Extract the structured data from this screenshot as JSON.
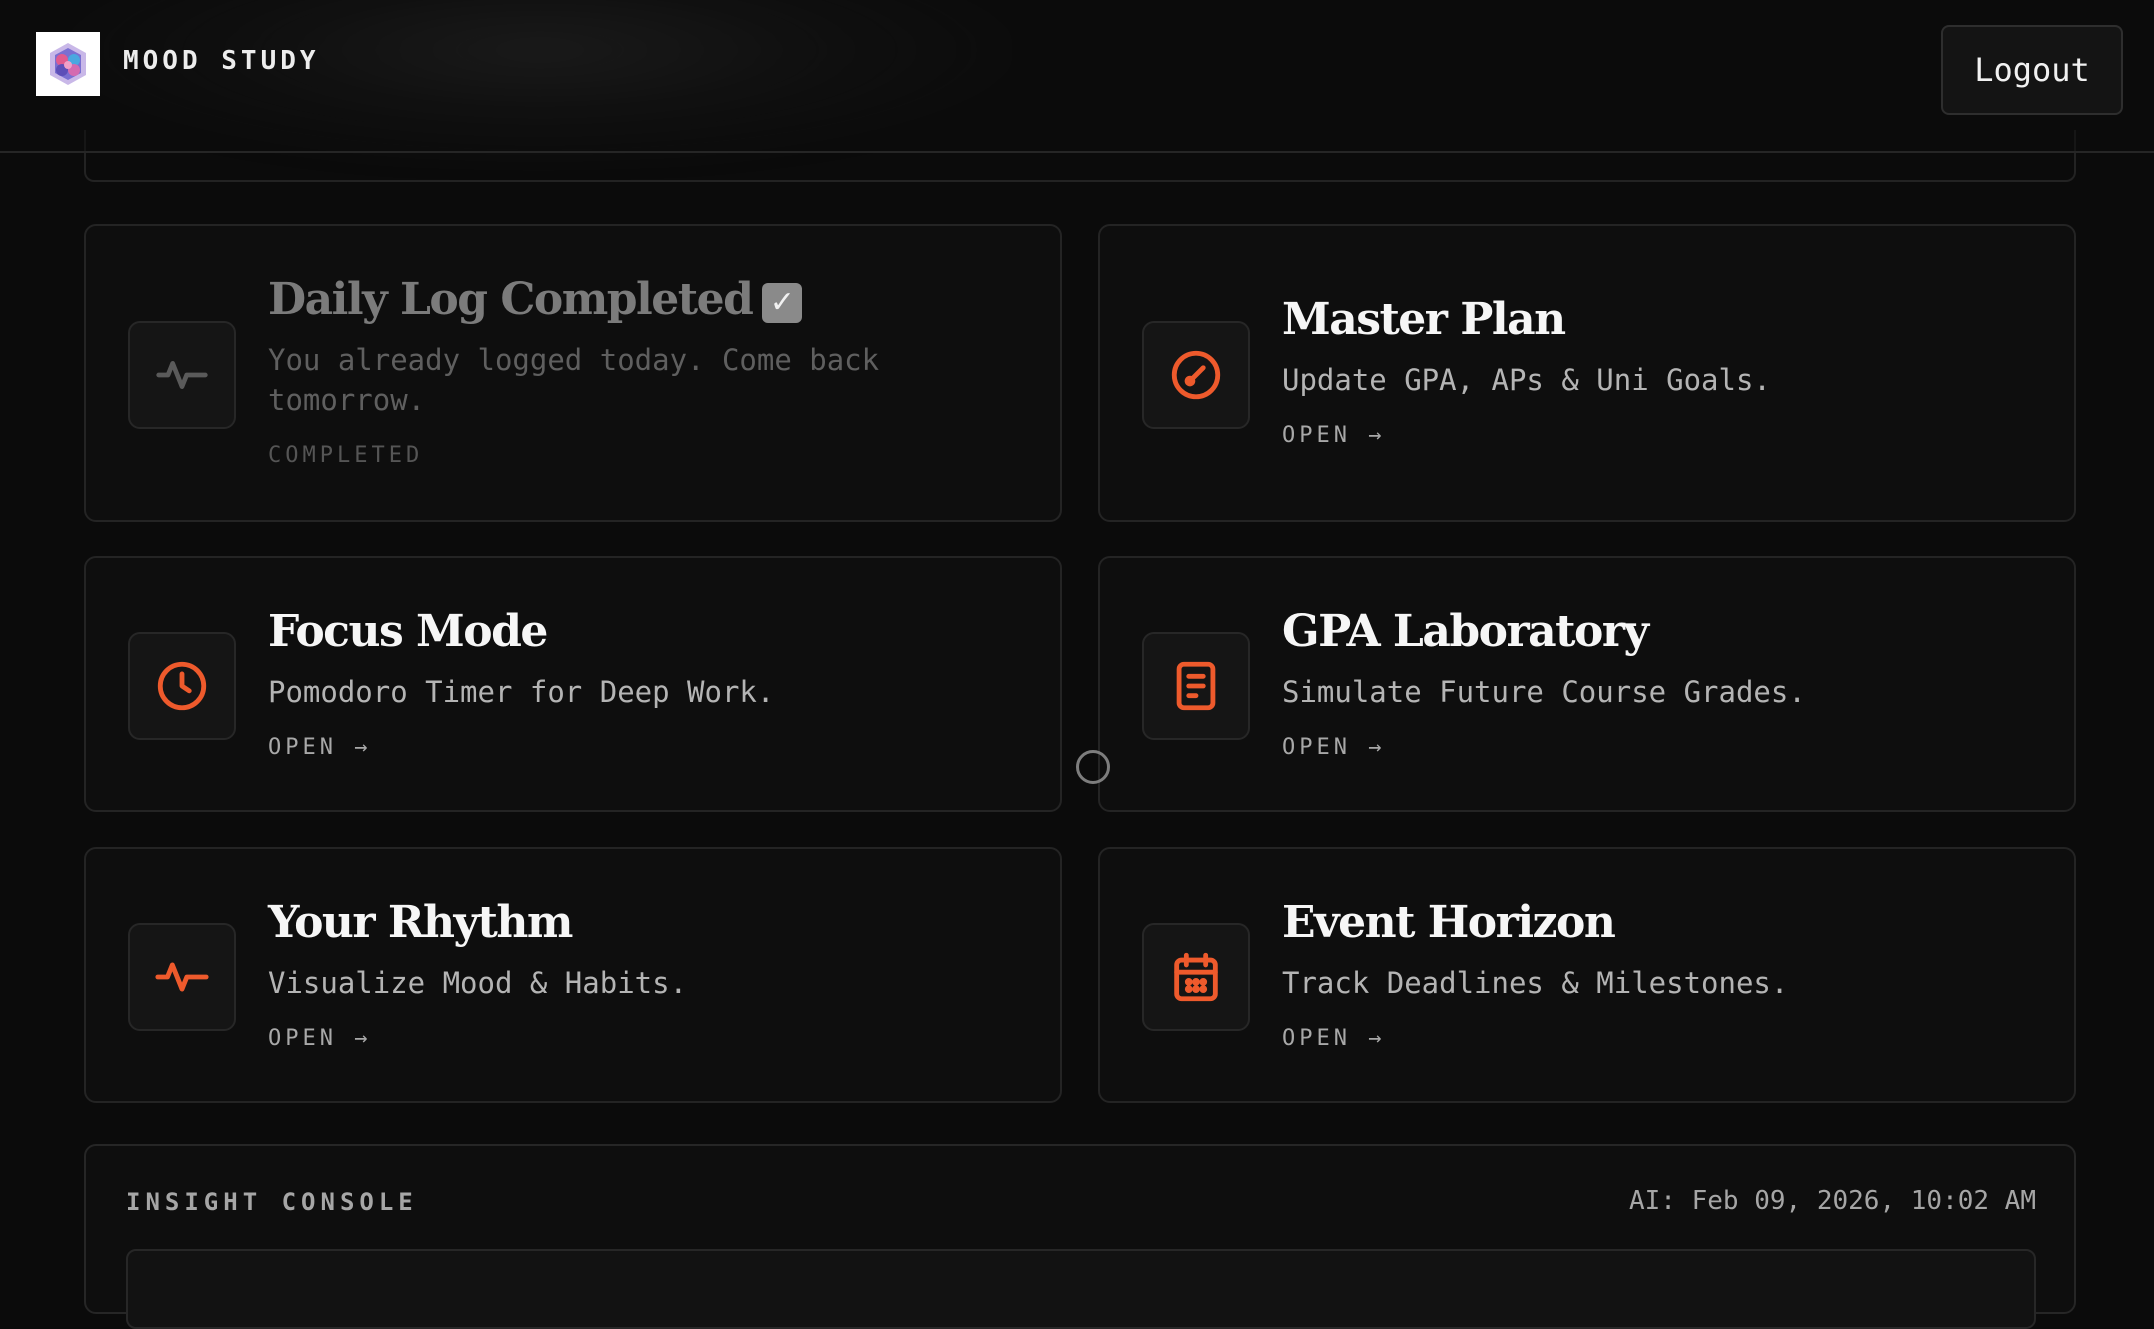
{
  "header": {
    "brand": "MOOD STUDY",
    "logout_label": "Logout"
  },
  "cards": [
    {
      "title": "Daily Log Completed",
      "check": "✓",
      "desc": "You already logged today. Come back tomorrow.",
      "action": "COMPLETED",
      "icon": "pulse-icon",
      "state": "completed"
    },
    {
      "title": "Master Plan",
      "desc": "Update GPA, APs & Uni Goals.",
      "action": "OPEN →",
      "icon": "compass-icon"
    },
    {
      "title": "Focus Mode",
      "desc": "Pomodoro Timer for Deep Work.",
      "action": "OPEN →",
      "icon": "clock-icon"
    },
    {
      "title": "GPA Laboratory",
      "desc": "Simulate Future Course Grades.",
      "action": "OPEN →",
      "icon": "document-icon"
    },
    {
      "title": "Your Rhythm",
      "desc": "Visualize Mood & Habits.",
      "action": "OPEN →",
      "icon": "activity-icon"
    },
    {
      "title": "Event Horizon",
      "desc": "Track Deadlines & Milestones.",
      "action": "OPEN →",
      "icon": "calendar-icon"
    }
  ],
  "console": {
    "title": "INSIGHT CONSOLE",
    "timestamp": "AI: Feb 09, 2026, 10:02 AM"
  },
  "colors": {
    "accent": "#ee5a2c",
    "background": "#0b0b0b",
    "card": "#0e0e0e"
  }
}
